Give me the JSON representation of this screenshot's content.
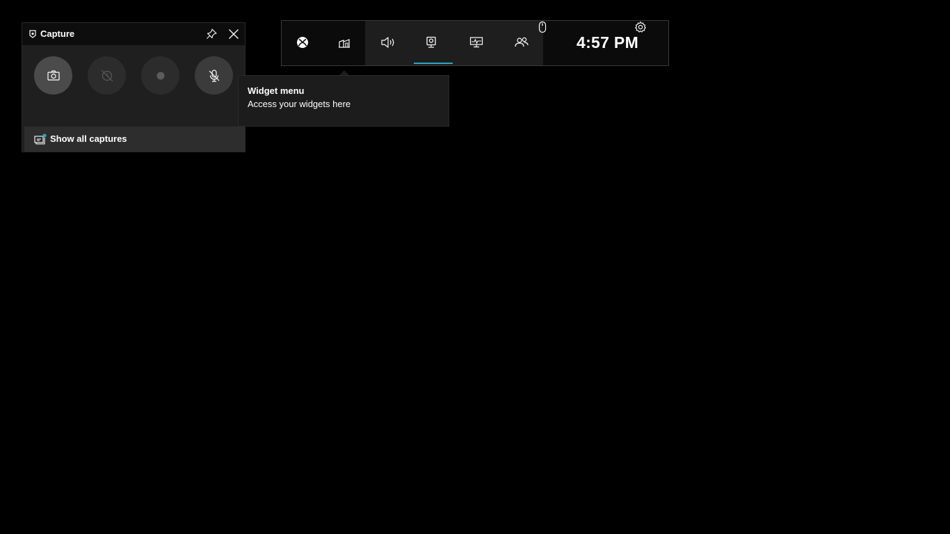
{
  "capture_widget": {
    "title": "Capture",
    "title_icon": "camera-badge-icon",
    "pin_icon": "pin-icon",
    "close_icon": "close-icon",
    "buttons": [
      {
        "icon": "screenshot-camera-icon",
        "state": "active"
      },
      {
        "icon": "record-last-disabled-icon",
        "state": "disabled"
      },
      {
        "icon": "record-dot-icon",
        "state": "disabled"
      },
      {
        "icon": "microphone-muted-icon",
        "state": "normal"
      }
    ],
    "footer_label": "Show all captures",
    "footer_icon": "gallery-icon",
    "footer_badge_color": "#2aa8c4"
  },
  "game_bar": {
    "left_icons": [
      "xbox-icon",
      "widget-menu-icon"
    ],
    "middle_icons": [
      "audio-icon",
      "capture-icon",
      "performance-icon",
      "social-icon"
    ],
    "active_tab": "capture-icon",
    "accent_color": "#2aa8c4",
    "mouse_icon": "mouse-icon",
    "clock": "4:57 PM",
    "settings_icon": "gear-icon"
  },
  "tooltip": {
    "title": "Widget menu",
    "body": "Access your widgets here"
  }
}
